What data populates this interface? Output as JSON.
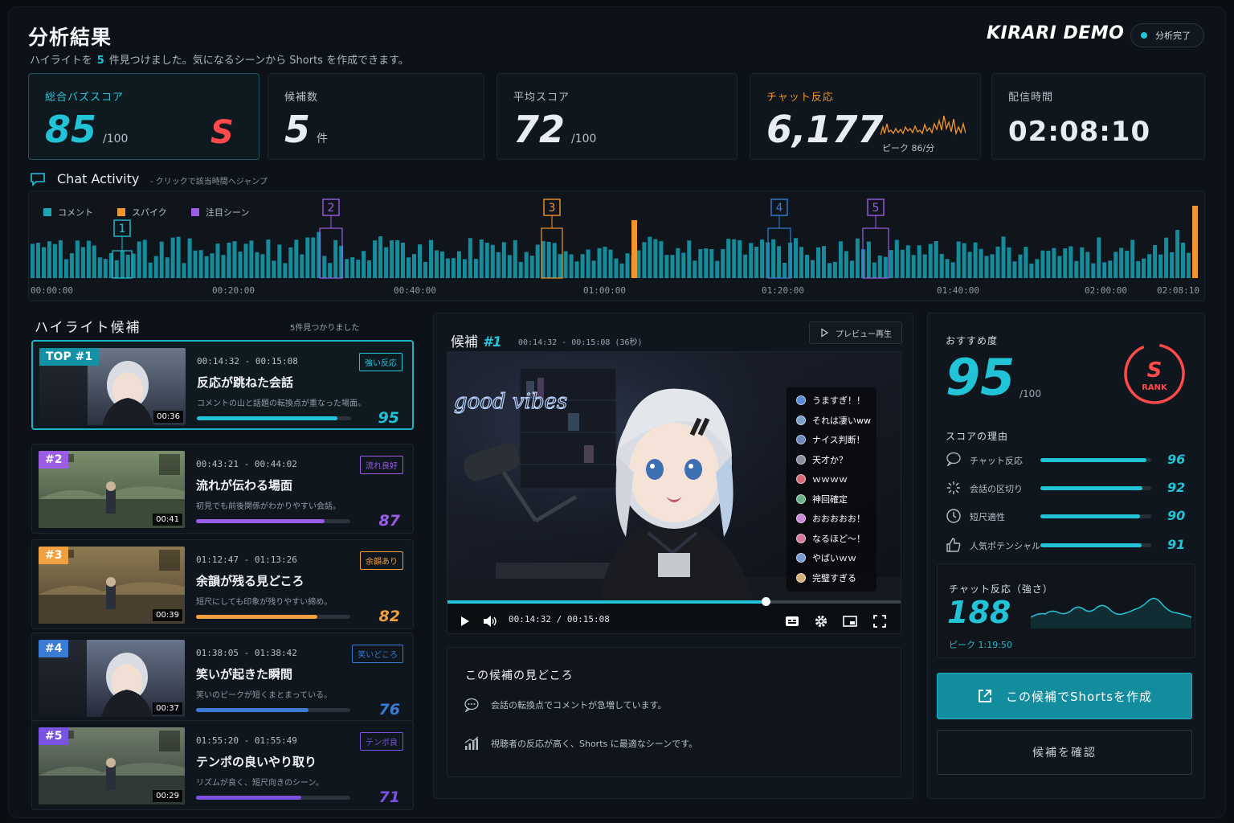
{
  "header": {
    "title": "分析結果",
    "subtitle_pre": "ハイライトを",
    "subtitle_count": "5",
    "subtitle_post": "件見つけました。気になるシーンから Shorts を作成できます。",
    "brand": "KIRARI DEMO",
    "status": "分析完了"
  },
  "kpis": {
    "buzz": {
      "label": "総合バズスコア",
      "value": "85",
      "unit": "/100",
      "grade": "S"
    },
    "candidates": {
      "label": "候補数",
      "value": "5",
      "unit": "件"
    },
    "average": {
      "label": "平均スコア",
      "value": "72",
      "unit": "/100"
    },
    "chat": {
      "label": "チャット反応",
      "value": "6,177",
      "peak": "ピーク 86/分"
    },
    "duration": {
      "label": "配信時間",
      "value": "02:08:10"
    }
  },
  "activity": {
    "title": "Chat Activity",
    "hint": "- クリックで該当時間へジャンプ",
    "legend": {
      "comment": "コメント",
      "spike": "スパイク",
      "focus": "注目シーン"
    },
    "ticks": [
      "00:00:00",
      "00:20:00",
      "00:40:00",
      "01:00:00",
      "01:20:00",
      "01:40:00",
      "02:00:00",
      "02:08:10"
    ],
    "markers": [
      "1",
      "2",
      "3",
      "4",
      "5"
    ]
  },
  "highlights": {
    "title": "ハイライト候補",
    "count_text": "5件見つかりました",
    "items": [
      {
        "rank": "TOP #1",
        "duration": "00:36",
        "time": "00:14:32 - 00:15:08",
        "tag": "強い反応",
        "title": "反応が跳ねた会話",
        "desc": "コメントの山と話題の転換点が重なった場面。",
        "score": "95",
        "score_num": 95,
        "color": "#22c3d6"
      },
      {
        "rank": "#2",
        "duration": "00:41",
        "time": "00:43:21 - 00:44:02",
        "tag": "流れ良好",
        "title": "流れが伝わる場面",
        "desc": "初見でも前後関係がわかりやすい会話。",
        "score": "87",
        "score_num": 87,
        "color": "#9b5de5"
      },
      {
        "rank": "#3",
        "duration": "00:39",
        "time": "01:12:47 - 01:13:26",
        "tag": "余韻あり",
        "title": "余韻が残る見どころ",
        "desc": "短尺にしても印象が残りやすい締め。",
        "score": "82",
        "score_num": 82,
        "color": "#f0a040"
      },
      {
        "rank": "#4",
        "duration": "00:37",
        "time": "01:38:05 - 01:38:42",
        "tag": "笑いどころ",
        "title": "笑いが起きた瞬間",
        "desc": "笑いのピークが短くまとまっている。",
        "score": "76",
        "score_num": 76,
        "color": "#3a7bd5"
      },
      {
        "rank": "#5",
        "duration": "00:29",
        "time": "01:55:20 - 01:55:49",
        "tag": "テンポ良",
        "title": "テンポの良いやり取り",
        "desc": "リズムが良く、短尺向きのシーン。",
        "score": "71",
        "score_num": 71,
        "color": "#7a54e0"
      }
    ]
  },
  "detail": {
    "title": "候補",
    "number": "#1",
    "time": "00:14:32 - 00:15:08 (36秒)",
    "preview_label": "プレビュー再生",
    "neon": "good vibes",
    "chat": [
      "うますぎ！！",
      "それは凄いww",
      "ナイス判断！",
      "天才か？",
      "ｗｗｗｗ",
      "神回確定",
      "おおおおお！",
      "なるほど～！",
      "やばいｗｗ",
      "完璧すぎる"
    ],
    "player_time": "00:14:32 / 00:15:08",
    "progress": 0.7,
    "points_title": "この候補の見どころ",
    "points": [
      "会話の転換点でコメントが急増しています。",
      "視聴者の反応が高く、Shorts に最適なシーンです。"
    ]
  },
  "recommend": {
    "label": "おすすめ度",
    "score": "95",
    "unit": "/100",
    "rank": "S",
    "rank_label": "RANK",
    "reasons_title": "スコアの理由",
    "reasons": [
      {
        "label": "チャット反応",
        "value": "96",
        "value_num": 96
      },
      {
        "label": "会話の区切り",
        "value": "92",
        "value_num": 92
      },
      {
        "label": "短尺適性",
        "value": "90",
        "value_num": 90
      },
      {
        "label": "人気ポテンシャル",
        "value": "91",
        "value_num": 91
      }
    ],
    "reaction_title": "チャット反応（強さ）",
    "reaction_value": "188",
    "reaction_peak": "ピーク 1:19:50",
    "create_button": "この候補でShortsを作成",
    "confirm_button": "候補を確認"
  },
  "colors": {
    "accent": "#22c3d6",
    "spike": "#f3952e",
    "focus": "#9b5de5",
    "grade": "#ff4a4a"
  }
}
